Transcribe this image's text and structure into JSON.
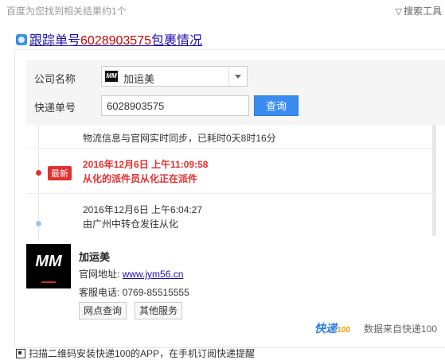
{
  "result_count_text": "百度为您找到相关结果约1个",
  "search_tools_label": "搜索工具",
  "title": {
    "prefix": "跟踪单号",
    "number": "6028903575",
    "suffix": "包裹情况"
  },
  "form": {
    "company_label": "公司名称",
    "company_value": "加运美",
    "tracking_label": "快递单号",
    "tracking_value": "6028903575",
    "query_button": "查询"
  },
  "timeline": {
    "sync_text": "物流信息与官网实时同步，已耗时0天8时16分",
    "new_badge": "最新",
    "events": [
      {
        "time": "2016年12月6日 上午11:09:58",
        "desc": "从化的派件员从化正在派件"
      },
      {
        "time": "2016年12月6日 上午6:04:27",
        "desc": "由广州中转仓发往从化"
      }
    ]
  },
  "company": {
    "logo_text": "MM",
    "name": "加运美",
    "website_label": "官网地址:",
    "website": "www.jym56.cn",
    "phone_label": "客服电话:",
    "phone": "0769-85515555",
    "buttons": [
      "网点查询",
      "其他服务"
    ]
  },
  "source": {
    "brand": "快递",
    "brand_num": "100",
    "text": "数据来自快递100"
  },
  "bottom_text": "扫描二维码安装快递100的APP，在手机订阅快递提醒",
  "colors": {
    "accent_red": "#e0312f",
    "link_blue": "#1a0dab",
    "button_blue": "#3b8cf0"
  }
}
